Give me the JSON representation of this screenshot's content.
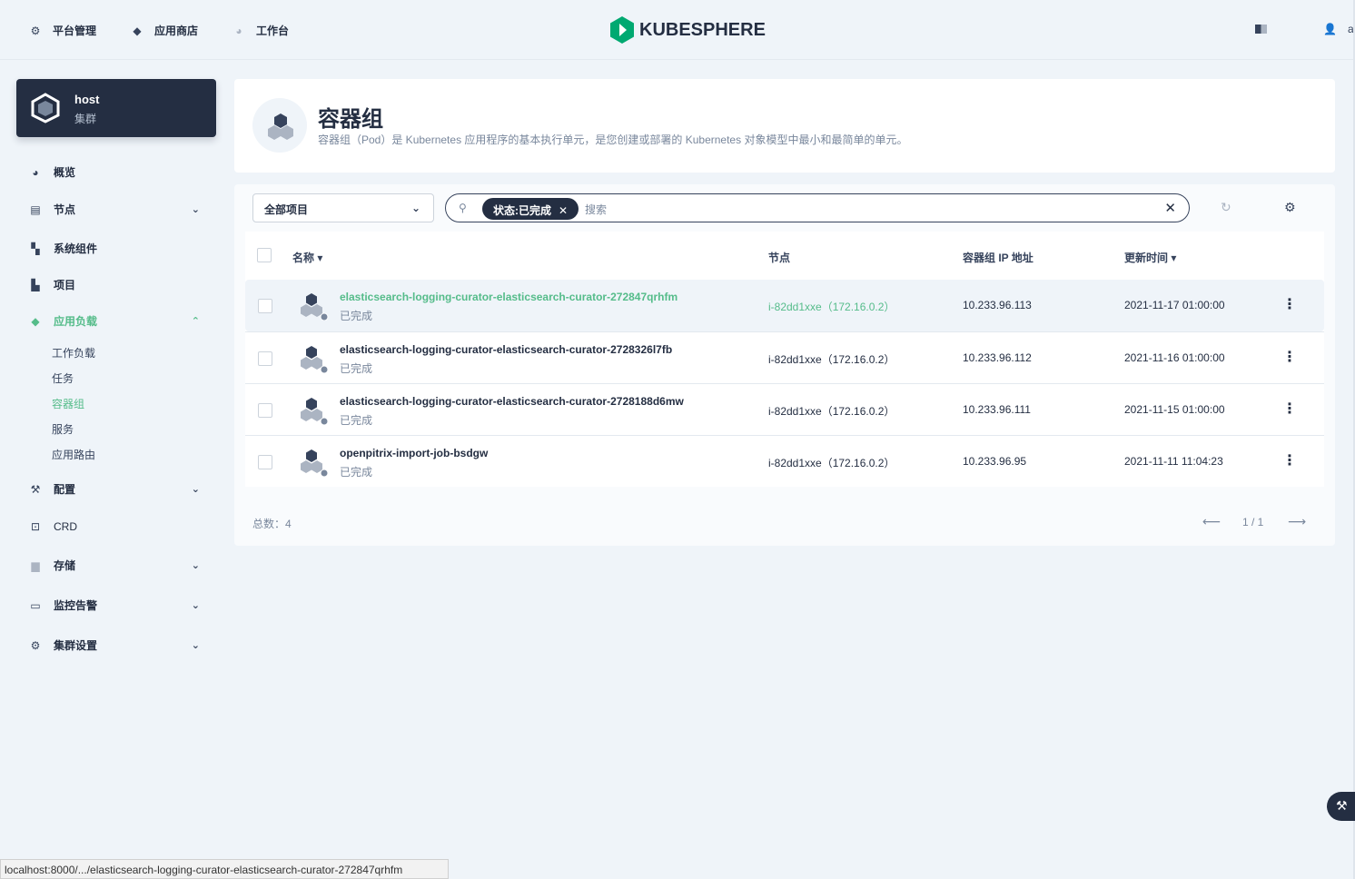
{
  "topnav": {
    "platform": "平台管理",
    "appstore": "应用商店",
    "workbench": "工作台"
  },
  "brand": "KUBESPHERE",
  "user": {
    "name": "admin"
  },
  "cluster": {
    "name": "host",
    "type": "集群"
  },
  "sidebar": {
    "items": [
      {
        "label": "概览"
      },
      {
        "label": "节点"
      },
      {
        "label": "系统组件"
      },
      {
        "label": "项目"
      },
      {
        "label": "应用负载"
      },
      {
        "label": "配置"
      },
      {
        "label": "CRD"
      },
      {
        "label": "存储"
      },
      {
        "label": "监控告警"
      },
      {
        "label": "集群设置"
      }
    ],
    "sub": [
      {
        "label": "工作负载"
      },
      {
        "label": "任务"
      },
      {
        "label": "容器组"
      },
      {
        "label": "服务"
      },
      {
        "label": "应用路由"
      }
    ]
  },
  "header": {
    "title": "容器组",
    "desc": "容器组（Pod）是 Kubernetes 应用程序的基本执行单元，是您创建或部署的 Kubernetes 对象模型中最小和最简单的单元。"
  },
  "toolbar": {
    "project": "全部项目",
    "filter_tag": "状态:已完成",
    "placeholder": "搜索"
  },
  "table": {
    "columns": {
      "name": "名称",
      "node": "节点",
      "ip": "容器组 IP 地址",
      "time": "更新时间"
    },
    "rows": [
      {
        "name": "elasticsearch-logging-curator-elasticsearch-curator-272847qrhfm",
        "status": "已完成",
        "node": "i-82dd1xxe（172.16.0.2）",
        "ip": "10.233.96.113",
        "time": "2021-11-17 01:00:00"
      },
      {
        "name": "elasticsearch-logging-curator-elasticsearch-curator-2728326l7fb",
        "status": "已完成",
        "node": "i-82dd1xxe（172.16.0.2）",
        "ip": "10.233.96.112",
        "time": "2021-11-16 01:00:00"
      },
      {
        "name": "elasticsearch-logging-curator-elasticsearch-curator-2728188d6mw",
        "status": "已完成",
        "node": "i-82dd1xxe（172.16.0.2）",
        "ip": "10.233.96.111",
        "time": "2021-11-15 01:00:00"
      },
      {
        "name": "openpitrix-import-job-bsdgw",
        "status": "已完成",
        "node": "i-82dd1xxe（172.16.0.2）",
        "ip": "10.233.96.95",
        "time": "2021-11-11 11:04:23"
      }
    ]
  },
  "footer": {
    "total": "总数：4",
    "page": "1 / 1"
  },
  "statusbar": "localhost:8000/.../elasticsearch-logging-curator-elasticsearch-curator-272847qrhfm",
  "colors": {
    "accent": "#55bc8a",
    "dark": "#242e42",
    "bg": "#eff4f9"
  }
}
